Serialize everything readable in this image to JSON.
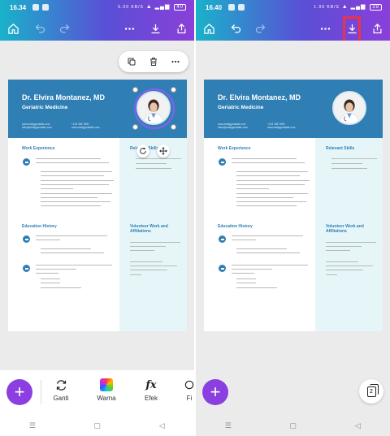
{
  "left": {
    "time": "16.34",
    "battery": "40",
    "net_speed": "5.00 KB/S"
  },
  "right": {
    "time": "16.40",
    "battery": "39",
    "net_speed": "1.00 KB/S"
  },
  "resume": {
    "name": "Dr. Elvira Montanez, MD",
    "specialty": "Geriatric Medicine",
    "contact_left": [
      "www.reallygreatsite.com",
      "hello@reallygreatsite.com"
    ],
    "contact_right": [
      "+123 456 7890",
      "www.reallygreatsite.com"
    ],
    "sections": {
      "work": "Work Experience",
      "skills": "Relevant Skills",
      "education": "Education History",
      "volunteer": "Volunteer Work and Affiliations"
    },
    "work_entry": {
      "title": "Physician | Lakeridge Medical",
      "dates": "March 2022 to August 2023 (1 years, 5 months)",
      "bullets": [
        "Supervised trainee physicians, which thus increased in number annually by 30%",
        "Provided health education to the public, leading to a 20% decline in severe conditions in the local units",
        "Improved efficiency by 40% by creating accessible and comprehensive health records in electronic and paper formats"
      ]
    },
    "skills_items": [
      "Hospice and Palliative Care",
      "Rheumatology",
      "Geriatric Medicine"
    ],
    "edu_entries": [
      {
        "title": "Doctor of Medicine | University of Medicine",
        "year": "Class of 2021",
        "bullets": [
          "Awarded Medical Scholarship",
          "Awarded Excellence in Leadership Award"
        ]
      },
      {
        "title": "Bachelor of Science in Human Biology | Geisel University",
        "year": "Class of 2019",
        "bullets": [
          "Cum Laude",
          "Best Thesis",
          "President, Biology Club"
        ]
      }
    ],
    "volunteer_entries": [
      {
        "title": "Member, Society of Hospice and Palliative Medicine",
        "dates": "2022 to Present"
      },
      {
        "title": "Volunteer Physician",
        "detail": "Needed Free Clinic, Lakeview",
        "detail2": "Children's Foundation",
        "dates": "2021"
      }
    ]
  },
  "context_menu": {
    "icons": [
      "duplicate-icon",
      "trash-icon",
      "more-icon"
    ]
  },
  "bottom_tools": [
    {
      "label": "Ganti",
      "icon": "replace-icon"
    },
    {
      "label": "Warna",
      "icon": "color-palette-icon"
    },
    {
      "label": "Efek",
      "icon": "fx-icon"
    },
    {
      "label": "Fi",
      "icon": "filter-icon"
    }
  ],
  "fab_label": "+",
  "pages_count": "2",
  "nav_labels": {
    "recents": "☰",
    "home": "▢",
    "back": "◁"
  },
  "fx_glyph": "fx",
  "colors": {
    "accent": "#8b3fe0",
    "resume_blue": "#2f7fb4",
    "highlight": "#e8334a",
    "sidebar_tint": "#e6f6f8"
  }
}
